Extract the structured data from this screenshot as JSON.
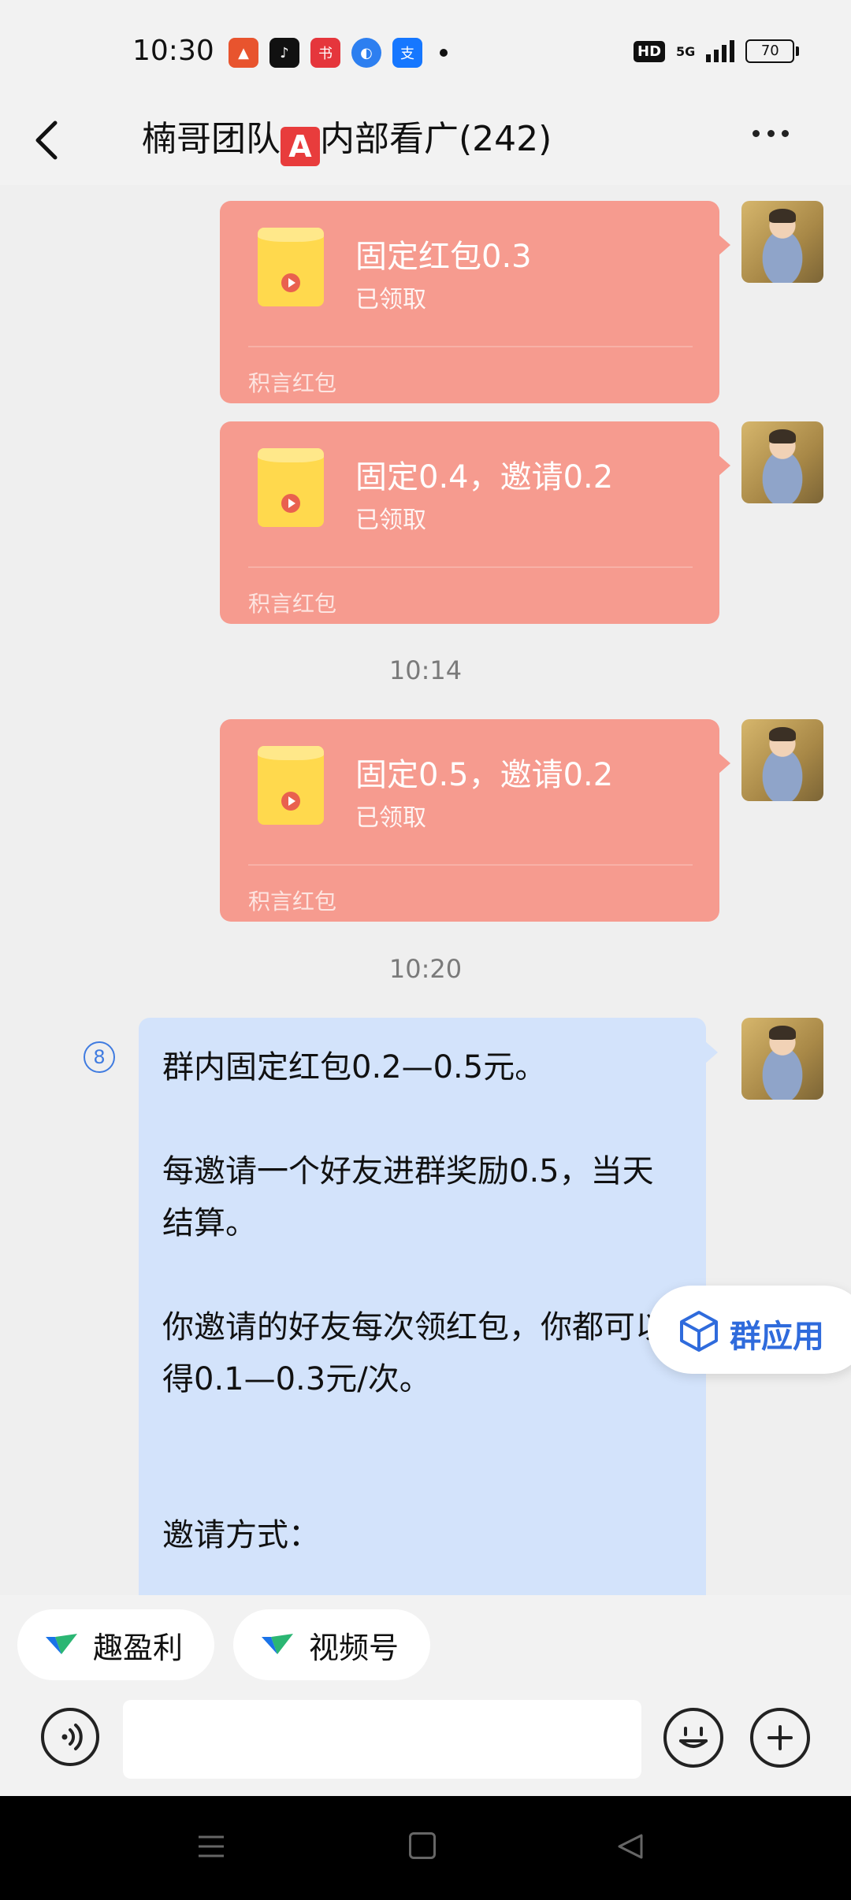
{
  "status_bar": {
    "time": "10:30",
    "app_icons": [
      "taobao-icon",
      "tiktok-icon",
      "xiaohongshu-icon",
      "browser-icon",
      "alipay-icon"
    ],
    "hd_label": "HD",
    "network": "5G",
    "battery": "70"
  },
  "header": {
    "title_prefix": "楠哥团队",
    "title_badge": "A",
    "title_suffix": "内部看广(242)"
  },
  "messages": [
    {
      "title": "固定红包0.3",
      "status": "已领取",
      "brand": "积言红包"
    },
    {
      "title": "固定0.4，邀请0.2",
      "status": "已领取",
      "brand": "积言红包"
    },
    {
      "title": "固定0.5，邀请0.2",
      "status": "已领取",
      "brand": "积言红包"
    }
  ],
  "timestamps": [
    "10:14",
    "10:20"
  ],
  "text_message": {
    "badge": "8",
    "text": "群内固定红包0.2—0.5元。\n\n每邀请一个好友进群奖励0.5，当天结算。\n\n你邀请的好友每次领红包，你都可以得0.1—0.3元/次。\n\n\n邀请方式："
  },
  "group_app": {
    "label": "群应用"
  },
  "quick_chips": [
    {
      "label": "趣盈利"
    },
    {
      "label": "视频号"
    }
  ],
  "input": {
    "value": ""
  },
  "colors": {
    "packet": "#f69b8f",
    "bubble": "#d3e3fb",
    "accent": "#2f6bdc"
  }
}
